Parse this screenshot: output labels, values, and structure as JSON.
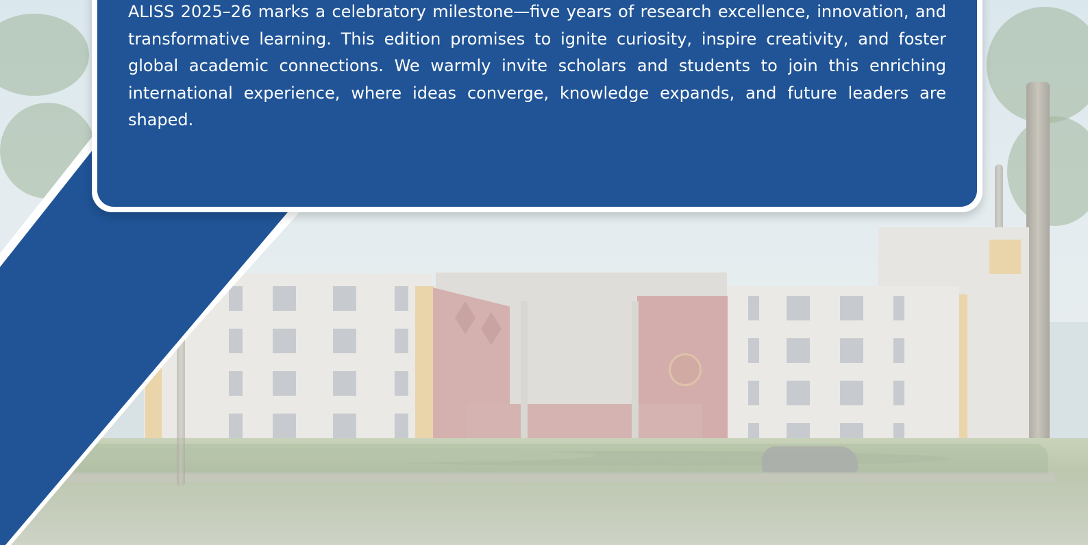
{
  "colors": {
    "brand_blue": "#205496",
    "card_border": "#ffffff"
  },
  "intro": {
    "paragraph": "ALISS 2025–26 marks a celebratory milestone—five years of research excellence, innovation, and transformative learning. This edition promises to ignite curiosity, inspire creativity, and foster global academic connections. We warmly invite scholars and students to join this enriching international experience, where ideas converge, knowledge expands, and future leaders are shaped."
  },
  "background": {
    "image": "campus-building-photo"
  }
}
